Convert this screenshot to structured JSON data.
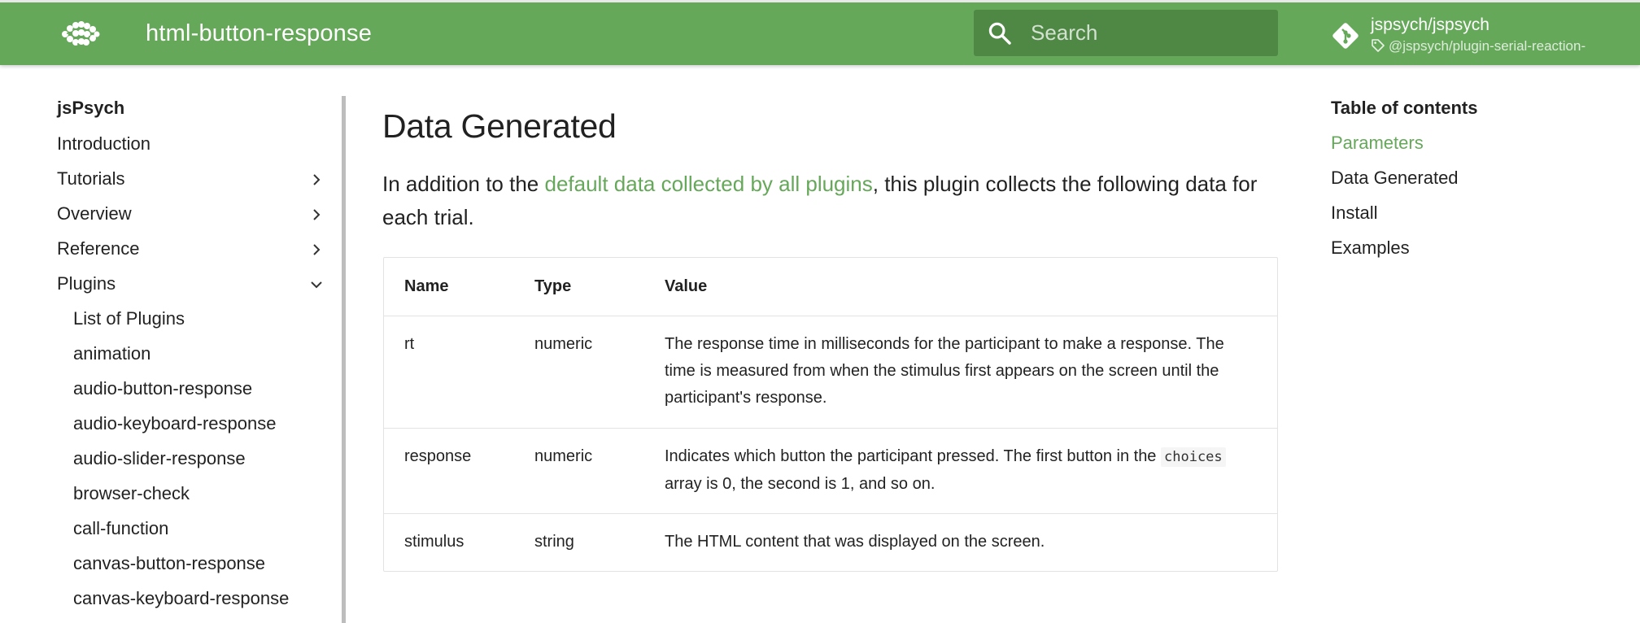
{
  "header": {
    "title": "html-button-response",
    "search_placeholder": "Search",
    "repo_name": "jspsych/jspsych",
    "repo_tag": "@jspsych/plugin-serial-reaction-"
  },
  "colors": {
    "brand": "#66a85a",
    "search_bg": "#4f8845",
    "link": "#66a85a"
  },
  "sidebar": {
    "heading": "jsPsych",
    "items": [
      {
        "label": "Introduction",
        "icon": ""
      },
      {
        "label": "Tutorials",
        "icon": "chevron-right-icon"
      },
      {
        "label": "Overview",
        "icon": "chevron-right-icon"
      },
      {
        "label": "Reference",
        "icon": "chevron-right-icon"
      },
      {
        "label": "Plugins",
        "icon": "chevron-down-icon"
      }
    ],
    "plugins": [
      "List of Plugins",
      "animation",
      "audio-button-response",
      "audio-keyboard-response",
      "audio-slider-response",
      "browser-check",
      "call-function",
      "canvas-button-response",
      "canvas-keyboard-response"
    ]
  },
  "main": {
    "heading": "Data Generated",
    "intro_before": "In addition to the ",
    "intro_link": "default data collected by all plugins",
    "intro_after": ", this plugin collects the following data for each trial.",
    "table": {
      "headers": [
        "Name",
        "Type",
        "Value"
      ],
      "rows": [
        {
          "name": "rt",
          "type": "numeric",
          "value": "The response time in milliseconds for the participant to make a response. The time is measured from when the stimulus first appears on the screen until the participant's response."
        },
        {
          "name": "response",
          "type": "numeric",
          "value_before": "Indicates which button the participant pressed. The first button in the ",
          "value_code": "choices",
          "value_after": " array is 0, the second is 1, and so on."
        },
        {
          "name": "stimulus",
          "type": "string",
          "value": "The HTML content that was displayed on the screen."
        }
      ]
    }
  },
  "toc": {
    "title": "Table of contents",
    "items": [
      "Parameters",
      "Data Generated",
      "Install",
      "Examples"
    ],
    "active_index": 0
  }
}
